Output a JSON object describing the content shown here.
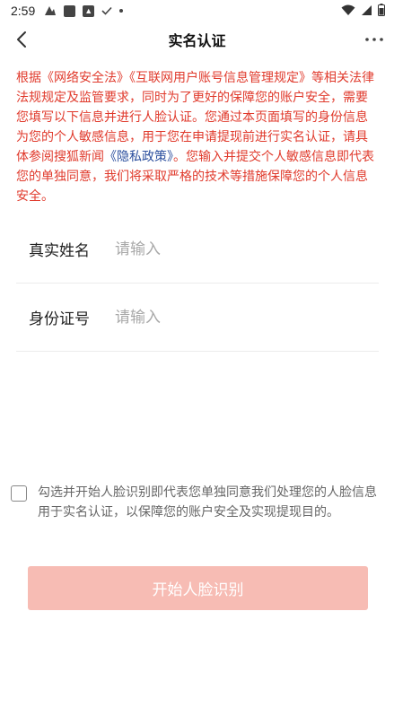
{
  "status_bar": {
    "time": "2:59"
  },
  "nav": {
    "title": "实名认证"
  },
  "notice": {
    "text_before_link": "根据《网络安全法》《互联网用户账号信息管理规定》等相关法律法规规定及监管要求，同时为了更好的保障您的账户安全，需要您填写以下信息并进行人脸认证。您通过本页面填写的身份信息为您的个人敏感信息，用于您在申请提现前进行实名认证，请具体参阅搜狐新闻",
    "link": "《隐私政策》",
    "text_after_link": "。您输入并提交个人敏感信息即代表您的单独同意，我们将采取严格的技术等措施保障您的个人信息安全。"
  },
  "form": {
    "name": {
      "label": "真实姓名",
      "placeholder": "请输入",
      "value": ""
    },
    "id_number": {
      "label": "身份证号",
      "placeholder": "请输入",
      "value": ""
    }
  },
  "agreement": {
    "text": "勾选并开始人脸识别即代表您单独同意我们处理您的人脸信息用于实名认证，以保障您的账户安全及实现提现目的。",
    "checked": false
  },
  "actions": {
    "start_label": "开始人脸识别"
  },
  "colors": {
    "notice_red": "#e03a2c",
    "link_blue": "#2c4f9e",
    "button_disabled": "#f7bcb4"
  }
}
